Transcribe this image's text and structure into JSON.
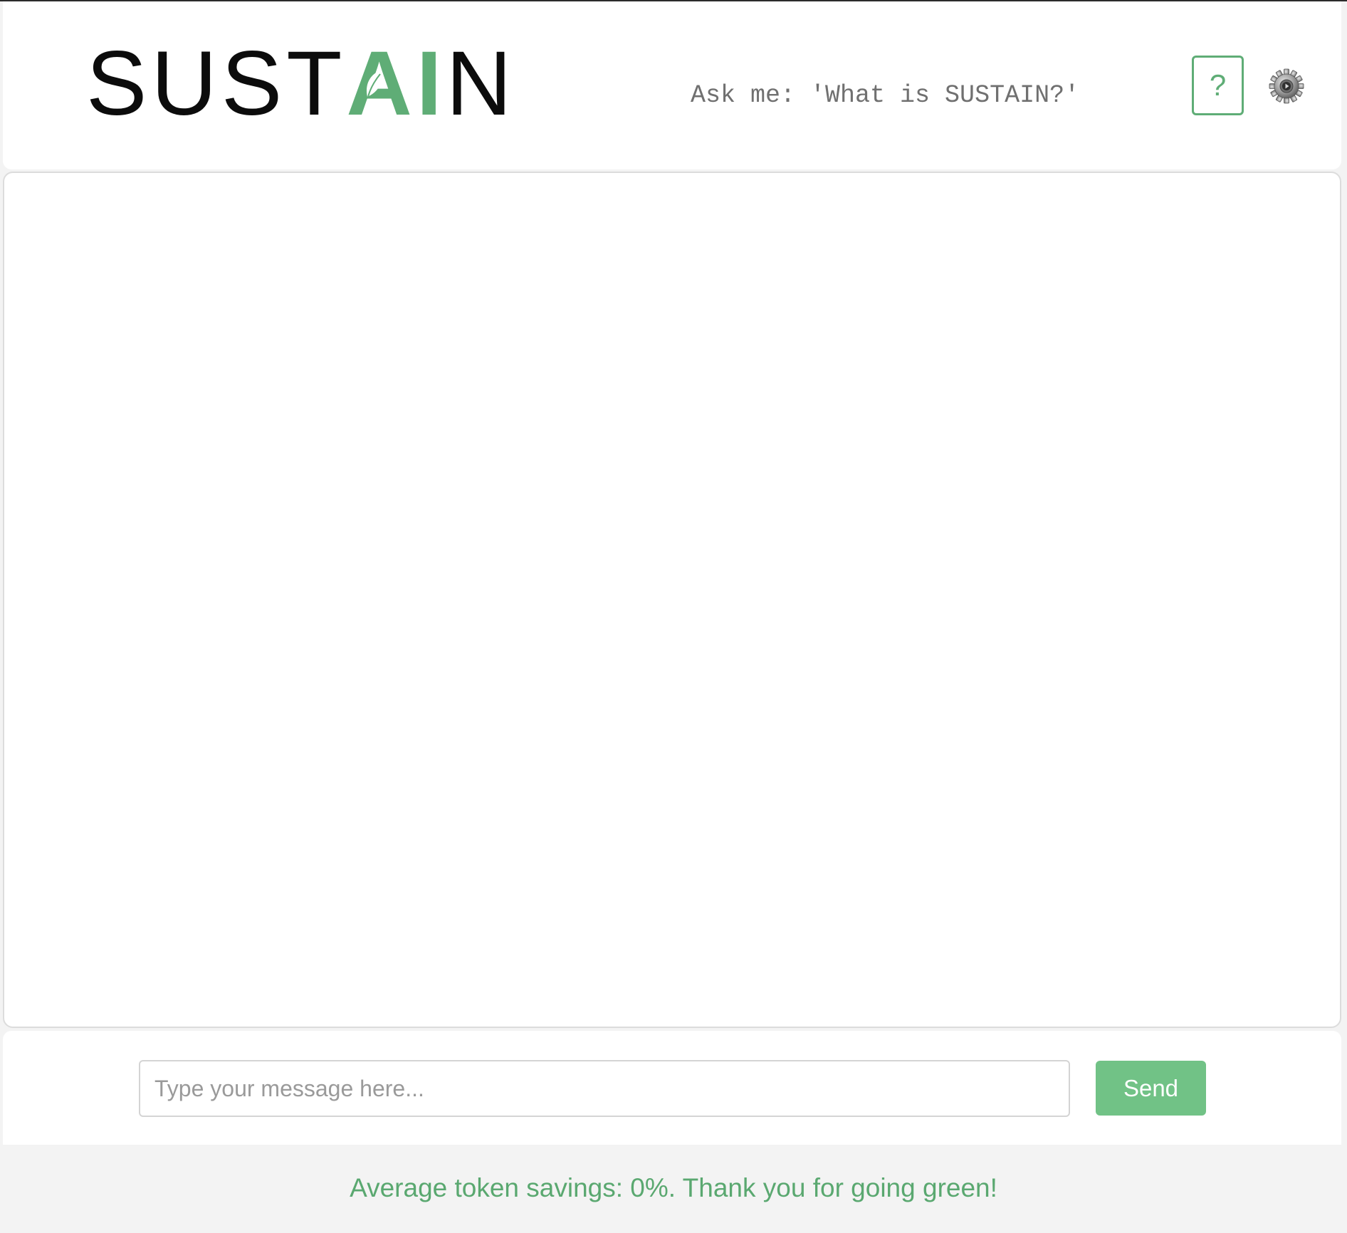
{
  "header": {
    "logo": {
      "text_before": "SUST",
      "text_accent": "AI",
      "text_after": "N"
    },
    "ask_prompt": "Ask me: 'What is SUSTAIN?'",
    "help_label": "?",
    "help_icon": "question-mark-icon",
    "settings_icon": "gear-icon"
  },
  "chat": {
    "messages": []
  },
  "composer": {
    "input_value": "",
    "input_placeholder": "Type your message here...",
    "send_label": "Send"
  },
  "footer": {
    "savings_text": "Average token savings: 0%. Thank you for going green!"
  },
  "colors": {
    "accent_green": "#5fad76",
    "button_green": "#71c286",
    "footer_green": "#5aa870"
  }
}
